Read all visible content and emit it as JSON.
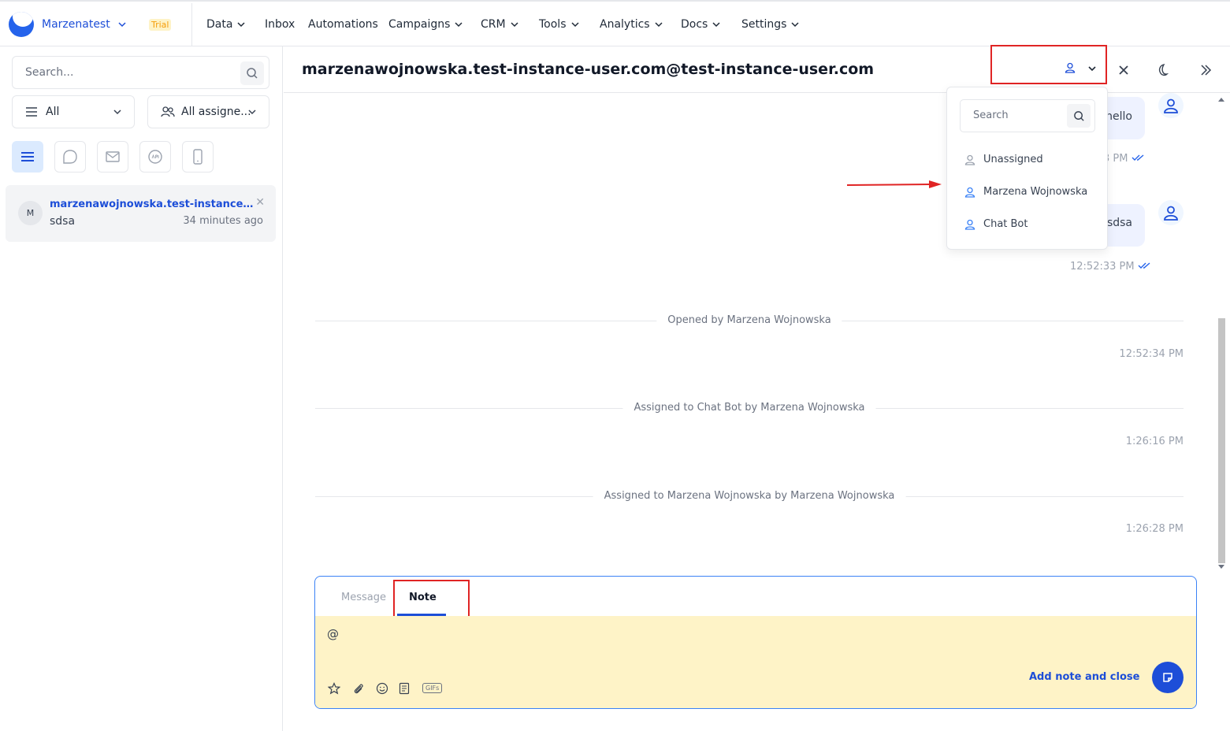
{
  "topbar": {
    "brand": "Marzenatest",
    "trial_badge": "Trial",
    "nav": [
      "Data",
      "Inbox",
      "Automations",
      "Campaigns",
      "CRM",
      "Tools",
      "Analytics",
      "Docs",
      "Settings"
    ]
  },
  "sidebar": {
    "search_placeholder": "Search...",
    "filter_status": "All",
    "filter_assignee": "All assigne...",
    "conversation": {
      "initial": "M",
      "name": "marzenawojnowska.test-instance-user.com@test-instance-user.com",
      "preview": "sdsa",
      "time": "34 minutes ago"
    }
  },
  "chat": {
    "title": "marzenawojnowska.test-instance-user.com@test-instance-user.com",
    "messages": [
      {
        "text": "hello",
        "time": "3 PM"
      },
      {
        "text": "sdsa",
        "time": "12:52:33 PM"
      }
    ],
    "events": [
      {
        "text": "Opened by Marzena Wojnowska",
        "time": "12:52:34 PM"
      },
      {
        "text": "Assigned to Chat Bot  by Marzena Wojnowska",
        "time": "1:26:16 PM"
      },
      {
        "text": "Assigned to Marzena Wojnowska by Marzena Wojnowska",
        "time": "1:26:28 PM"
      }
    ]
  },
  "assign_dropdown": {
    "search_placeholder": "Search",
    "options": [
      "Unassigned",
      "Marzena Wojnowska",
      "Chat Bot"
    ]
  },
  "composer": {
    "tab_message": "Message",
    "tab_note": "Note",
    "note_text": "@",
    "gif_label": "GIFs",
    "add_note_close": "Add note and close"
  },
  "colors": {
    "accent": "#1d4ed8",
    "highlight": "#e02424",
    "note_bg": "#fef3c7"
  }
}
